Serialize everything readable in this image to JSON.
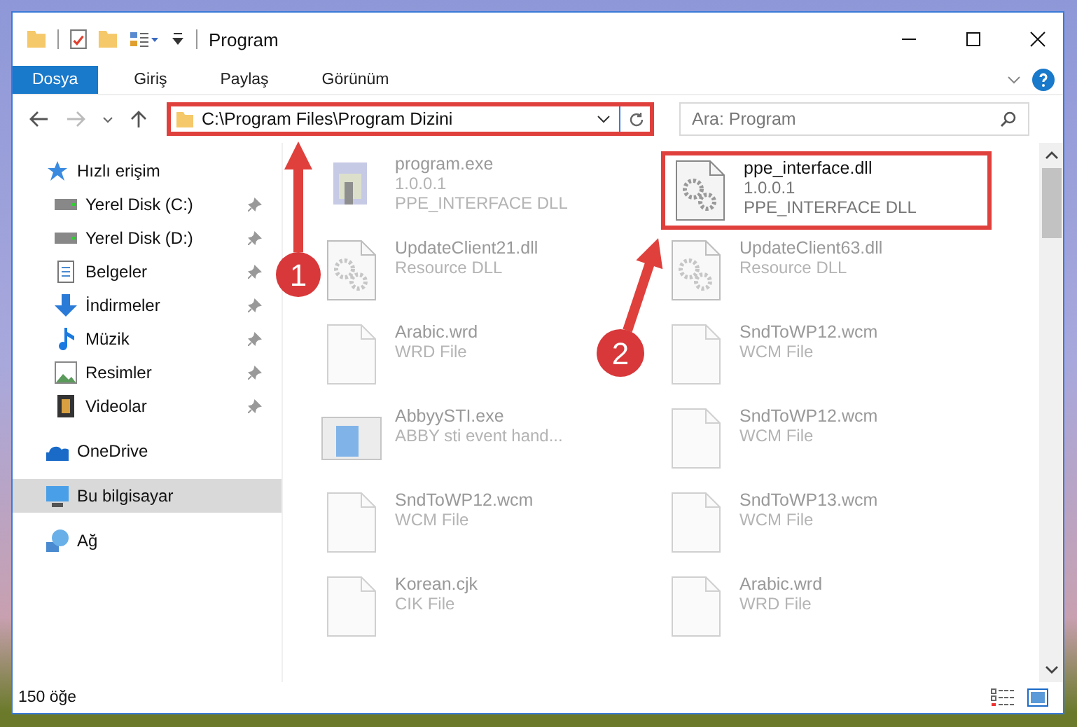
{
  "window": {
    "title": "Program"
  },
  "ribbon_tabs": [
    {
      "label": "Dosya",
      "selected": true
    },
    {
      "label": "Giriş",
      "selected": false
    },
    {
      "label": "Paylaş",
      "selected": false
    },
    {
      "label": "Görünüm",
      "selected": false
    }
  ],
  "address_bar": {
    "path": "C:\\Program Files\\Program Dizini",
    "marked": true
  },
  "search": {
    "placeholder": "Ara: Program"
  },
  "sidebar": {
    "items": [
      {
        "label": "Hızlı erişim",
        "selected": false,
        "children": [
          {
            "label": "Yerel Disk (C:)",
            "pinned": true,
            "selected": false
          },
          {
            "label": "Yerel Disk (D:)",
            "pinned": true,
            "selected": false
          },
          {
            "label": "Belgeler",
            "pinned": true,
            "selected": false
          },
          {
            "label": "İndirmeler",
            "pinned": true,
            "selected": false
          },
          {
            "label": "Müzik",
            "pinned": true,
            "selected": false
          },
          {
            "label": "Resimler",
            "pinned": true,
            "selected": false
          },
          {
            "label": "Videolar",
            "pinned": true,
            "selected": false
          }
        ]
      },
      {
        "label": "OneDrive",
        "selected": false
      },
      {
        "label": "Bu bilgisayar",
        "selected": true
      },
      {
        "label": "Ağ",
        "selected": false
      }
    ]
  },
  "files": [
    {
      "kind": "exe",
      "name": "program.exe",
      "lines": [
        "1.0.0.1",
        "PPE_INTERFACE DLL"
      ],
      "blurred": true,
      "marked": false
    },
    {
      "kind": "dll",
      "name": "ppe_interface.dll",
      "lines": [
        "1.0.0.1",
        "PPE_INTERFACE DLL"
      ],
      "blurred": false,
      "marked": true
    },
    {
      "kind": "dll",
      "name": "UpdateClient21.dll",
      "lines": [
        "Resource DLL"
      ],
      "blurred": true,
      "marked": false
    },
    {
      "kind": "dll",
      "name": "UpdateClient63.dll",
      "lines": [
        "Resource DLL"
      ],
      "blurred": true,
      "marked": false
    },
    {
      "kind": "file",
      "name": "Arabic.wrd",
      "lines": [
        "WRD File"
      ],
      "blurred": true,
      "marked": false
    },
    {
      "kind": "file",
      "name": "SndToWP12.wcm",
      "lines": [
        "WCM File"
      ],
      "blurred": true,
      "marked": false
    },
    {
      "kind": "app",
      "name": "AbbyySTI.exe",
      "lines": [
        "ABBY sti event hand..."
      ],
      "blurred": true,
      "marked": false
    },
    {
      "kind": "file",
      "name": "SndToWP12.wcm",
      "lines": [
        "WCM File"
      ],
      "blurred": true,
      "marked": false
    },
    {
      "kind": "file",
      "name": "SndToWP12.wcm",
      "lines": [
        "WCM File"
      ],
      "blurred": true,
      "marked": false
    },
    {
      "kind": "file",
      "name": "SndToWP13.wcm",
      "lines": [
        "WCM File"
      ],
      "blurred": true,
      "marked": false
    },
    {
      "kind": "file",
      "name": "Korean.cjk",
      "lines": [
        "CIK File"
      ],
      "blurred": true,
      "marked": false
    },
    {
      "kind": "file",
      "name": "Arabic.wrd",
      "lines": [
        "WRD File"
      ],
      "blurred": true,
      "marked": false
    }
  ],
  "status_bar": {
    "count": "150 öğe"
  },
  "annotations": [
    {
      "number": "1"
    },
    {
      "number": "2"
    }
  ]
}
